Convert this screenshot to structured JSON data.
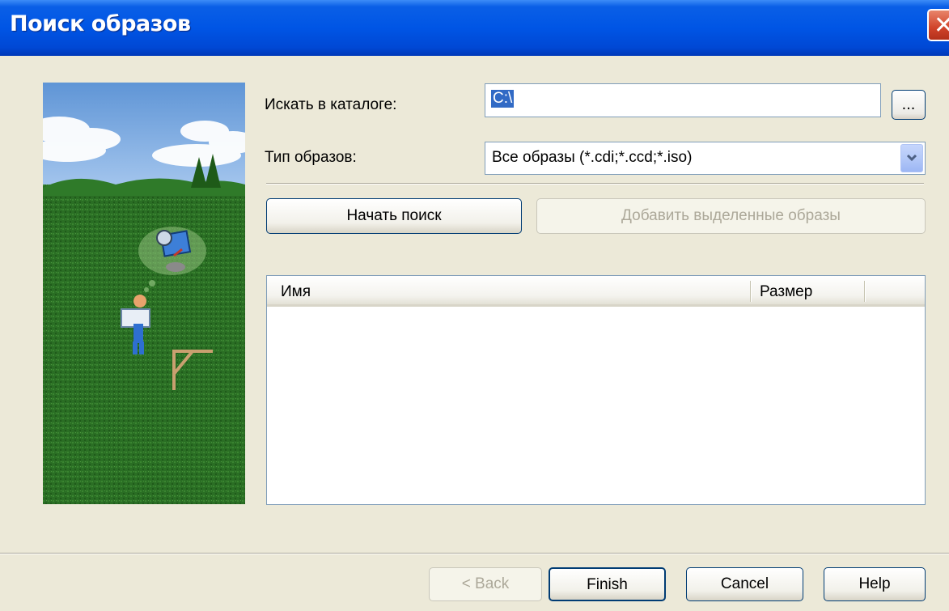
{
  "window": {
    "title": "Поиск образов",
    "close_glyph": "✕"
  },
  "form": {
    "folder_label": "Искать в каталоге:",
    "folder_value": "C:\\",
    "browse_label": "...",
    "type_label": "Тип образов:",
    "type_value": "Все образы (*.cdi;*.ccd;*.iso)"
  },
  "actions": {
    "start_search": "Начать поиск",
    "add_selected": "Добавить выделенные образы"
  },
  "list": {
    "columns": [
      "Имя",
      "Размер"
    ],
    "rows": []
  },
  "footer": {
    "back": "< Back",
    "finish": "Finish",
    "cancel": "Cancel",
    "help": "Help"
  },
  "icons": [
    "close-icon",
    "combo-arrow-icon",
    "wizard-illustration"
  ],
  "colors": {
    "titlebar": "#0055e5",
    "dialog_bg": "#ece9d8",
    "selection": "#316ac5",
    "close": "#d0432a"
  }
}
